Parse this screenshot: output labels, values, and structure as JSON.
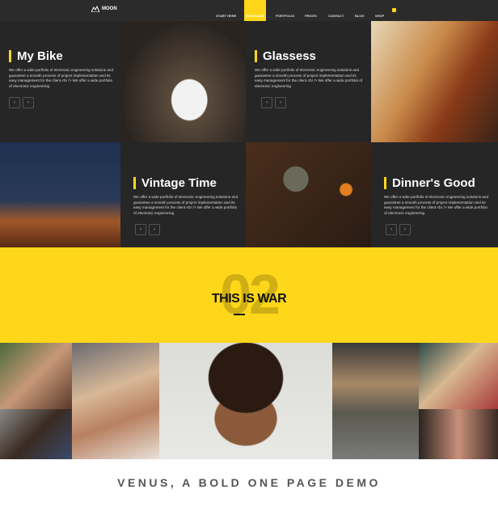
{
  "header": {
    "logo": "MOON",
    "nav": [
      "START HERE",
      "SHOWCASE",
      "PORTFOLIO",
      "PRICES",
      "CONTACT",
      "BLOG",
      "SHOP"
    ],
    "active": "SHOWCASE",
    "accent": "#fed71a"
  },
  "tiles": [
    {
      "title": "My Bike",
      "desc": "We offer a wide portfolio of electronic engineering solutions and guarantee a smooth process of project implementation and its easy management for the client.<br /> We offer a wide portfolio of electronic engineering"
    },
    {
      "title": "Glassess",
      "desc": "We offer a wide portfolio of electronic engineering solutions and guarantee a smooth process of project implementation and its easy management for the client.<br /> We offer a wide portfolio of electronic engineering"
    },
    {
      "title": "Vintage Time",
      "desc": "We offer a wide portfolio of electronic engineering solutions and guarantee a smooth process of project implementation and its easy management for the client.<br /> We offer a wide portfolio of electronic engineering"
    },
    {
      "title": "Dinner's Good",
      "desc": "We offer a wide portfolio of electronic engineering solutions and guarantee a smooth process of project implementation and its easy management for the client.<br /> We offer a wide portfolio of electronic engineering"
    }
  ],
  "arrows": {
    "prev": "‹",
    "next": "›"
  },
  "section": {
    "number": "02",
    "title": "THIS IS WAR"
  },
  "footer": {
    "caption": "VENUS, A BOLD ONE PAGE DEMO"
  }
}
